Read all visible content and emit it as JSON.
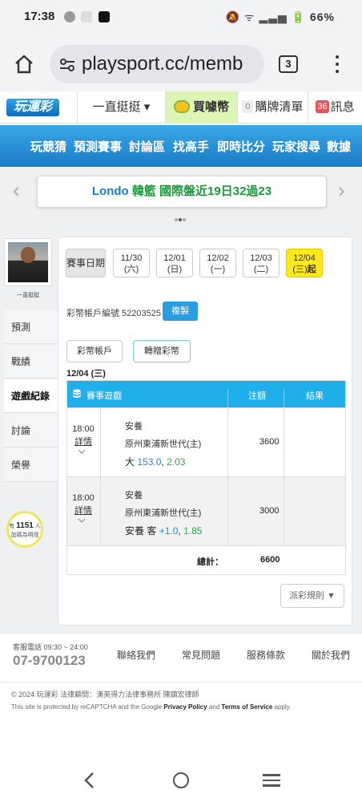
{
  "status": {
    "time": "17:38",
    "right_text": "66%"
  },
  "browser": {
    "url": "playsport.cc/memb",
    "tab_count": "3"
  },
  "site": {
    "logo": "玩運彩",
    "nav": {
      "mode": "一直挺挺 ▾",
      "buy": "買噱幣",
      "cart_count": "0",
      "cart": "購牌清單",
      "msg_count": "36",
      "msg": "訊息"
    },
    "menu": [
      "玩競猜",
      "預測賽事",
      "討論區",
      "找高手",
      "即時比分",
      "玩家搜尋",
      "數據"
    ]
  },
  "ticker": {
    "prefix": "Londo",
    "text": "韓籃 國際盤近19日32過23"
  },
  "sidebar": {
    "username": "一直挺挺",
    "items": [
      "預測",
      "戰績",
      "遊戲紀錄",
      "討論",
      "榮譽"
    ],
    "promo": {
      "count": "1151",
      "unit": "人",
      "text": "加碼為明燈",
      "prefix": "有"
    }
  },
  "dates": {
    "label": "賽事日期",
    "items": [
      {
        "d": "11/30",
        "w": "(六)"
      },
      {
        "d": "12/01",
        "w": "(日)"
      },
      {
        "d": "12/02",
        "w": "(一)"
      },
      {
        "d": "12/03",
        "w": "(二)"
      },
      {
        "d": "12/04",
        "w": "(三)",
        "suffix": "起"
      }
    ]
  },
  "account": {
    "label": "彩幣帳戶編號 52203525",
    "copy": "複製"
  },
  "tabs": [
    "彩幣帳戶",
    "轉贈彩幣"
  ],
  "table": {
    "date": "12/04 (三)",
    "headers": {
      "game": "賽事遊戲",
      "amount": "注額",
      "result": "結果"
    },
    "rows": [
      {
        "time": "18:00",
        "detail": "詳情",
        "team1": "安養",
        "team2": "原州東浦新世代(主)",
        "pick": "大",
        "line": "153.0",
        "odds": "2.03",
        "amount": "3600"
      },
      {
        "time": "18:00",
        "detail": "詳情",
        "team1": "安養",
        "team2": "原州東浦新世代(主)",
        "pick": "安養 客",
        "line": "+1.0",
        "odds": "1.85",
        "amount": "3000"
      }
    ],
    "total_label": "總計：",
    "total": "6600"
  },
  "rules_btn": "派彩規則 ▼",
  "footer": {
    "service": "客服電話 09:30 ~ 24:00",
    "phone": "07-9700123",
    "links": [
      "聯絡我們",
      "常見問題",
      "服務條款",
      "關於我們"
    ],
    "copyright": "© 2024 玩運彩 法律顧問：漢英得力法律事務所 陳鎮宏律師",
    "recaptcha_a": "This site is protected by reCAPTCHA and the Google",
    "privacy": "Privacy Policy",
    "and": "and",
    "terms": "Terms of Service",
    "apply": "apply."
  }
}
